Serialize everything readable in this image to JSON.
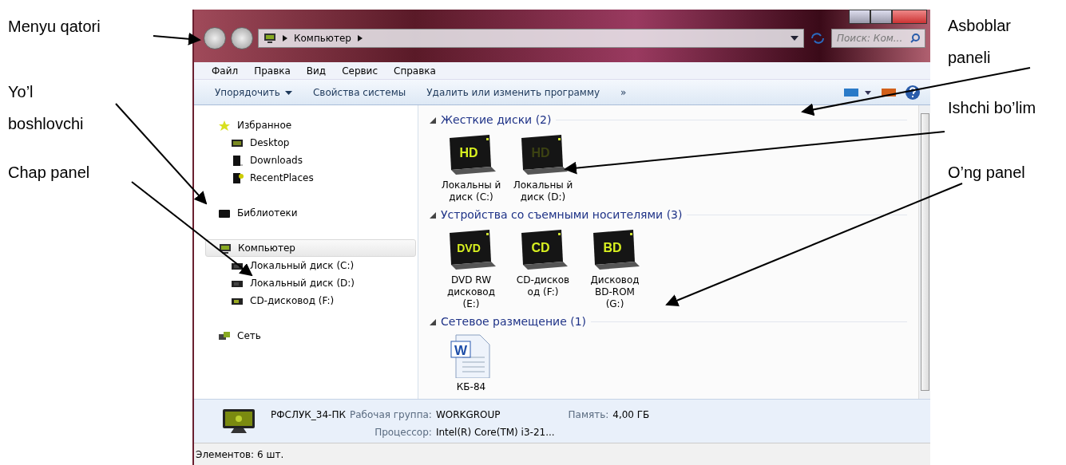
{
  "annotations": {
    "left": [
      {
        "text": "Menyu qatori"
      },
      {
        "text": "Yo’l boshlovchi"
      },
      {
        "text": "Chap panel"
      }
    ],
    "right": [
      {
        "text": "Asboblar paneli"
      },
      {
        "text": "Ishchi bo’lim"
      },
      {
        "text": "O’ng panel"
      }
    ]
  },
  "window": {
    "address": {
      "path": "Компьютер"
    },
    "search": {
      "placeholder": "Поиск: Ком..."
    },
    "menu": [
      "Файл",
      "Правка",
      "Вид",
      "Сервис",
      "Справка"
    ],
    "toolbar": [
      {
        "label": "Упорядочить",
        "kind": "dropdown"
      },
      {
        "label": "Свойства системы",
        "kind": "button"
      },
      {
        "label": "Удалить или изменить программу",
        "kind": "button"
      },
      {
        "label": "»",
        "kind": "button"
      }
    ],
    "nav": [
      {
        "label": "Избранное",
        "kind": "star",
        "selected": false,
        "children": [
          {
            "label": "Desktop",
            "kind": "desktop",
            "selected": false
          },
          {
            "label": "Downloads",
            "kind": "downloads",
            "selected": false
          },
          {
            "label": "RecentPlaces",
            "kind": "recent",
            "selected": false
          }
        ]
      },
      {
        "label": "Библиотеки",
        "kind": "library",
        "selected": false
      },
      {
        "label": "Компьютер",
        "kind": "computer",
        "selected": true,
        "children": [
          {
            "label": "Локальный диск (C:)",
            "kind": "disk",
            "selected": false
          },
          {
            "label": "Локальный диск (D:)",
            "kind": "disk",
            "selected": false
          },
          {
            "label": "CD-дисковод (F:)",
            "kind": "cd",
            "selected": false
          }
        ]
      },
      {
        "label": "Сеть",
        "kind": "network",
        "selected": false
      }
    ],
    "groups": [
      {
        "title": "Жесткие диски (2)",
        "expanded": true,
        "items": [
          {
            "label": "Локальны й диск (C:)",
            "kind": "drive",
            "badge": "HD",
            "dim": false
          },
          {
            "label": "Локальны й диск (D:)",
            "kind": "drive",
            "badge": "HD",
            "dim": true
          }
        ]
      },
      {
        "title": "Устройства со съемными носителями (3)",
        "expanded": true,
        "items": [
          {
            "label": "DVD RW дисковод (E:)",
            "kind": "drive",
            "badge": "DVD",
            "dim": false
          },
          {
            "label": "CD-дисков од (F:)",
            "kind": "drive",
            "badge": "CD",
            "dim": false
          },
          {
            "label": "Дисковод BD-ROM (G:)",
            "kind": "drive",
            "badge": "BD",
            "dim": false
          }
        ]
      },
      {
        "title": "Сетевое размещение (1)",
        "expanded": true,
        "items": [
          {
            "label": "КБ-84",
            "kind": "document",
            "badge": "W"
          }
        ]
      }
    ],
    "details": {
      "name": "РФСЛУК_34-ПК",
      "fields": [
        {
          "label": "Рабочая группа:",
          "value": "WORKGROUP"
        },
        {
          "label": "Память:",
          "value": "4,00 ГБ"
        },
        {
          "label": "Процессор:",
          "value": "Intel(R) Core(TM) i3-21..."
        }
      ]
    },
    "status": "Элементов: 6 шт."
  }
}
